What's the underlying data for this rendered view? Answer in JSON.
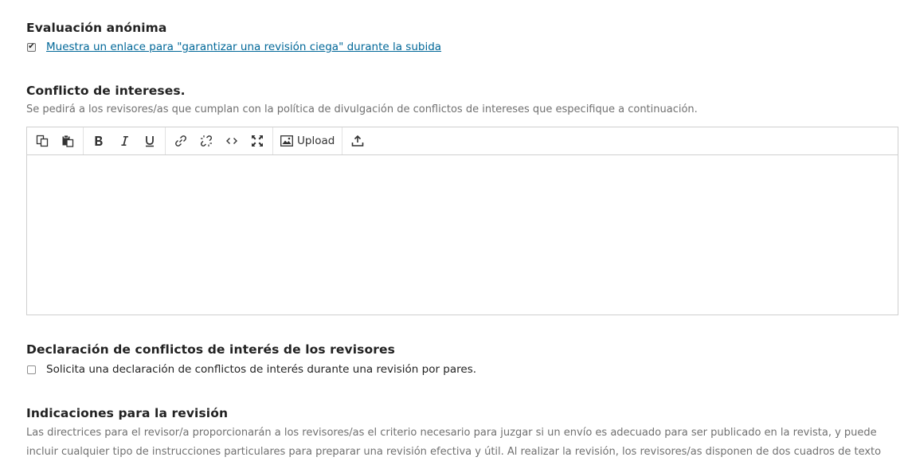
{
  "anonymous_review": {
    "title": "Evaluación anónima",
    "checkbox_checked": true,
    "checkbox_label": "Muestra un enlace para \"garantizar una revisión ciega\" durante la subida"
  },
  "conflict_of_interest": {
    "title": "Conflicto de intereses.",
    "description": "Se pedirá a los revisores/as que cumplan con la política de divulgación de conflictos de intereses que especifique a continuación.",
    "editor": {
      "toolbar": {
        "upload_label": "Upload"
      },
      "content": ""
    }
  },
  "reviewer_competing_interests": {
    "title": "Declaración de conflictos de interés de los revisores",
    "checkbox_checked": false,
    "checkbox_label": "Solicita una declaración de conflictos de interés durante una revisión por pares."
  },
  "review_guidelines": {
    "title": "Indicaciones para la revisión",
    "description_line1": "Las directrices para el revisor/a proporcionarán a los revisores/as el criterio necesario para juzgar si un envío es adecuado para ser publicado en la revista, y puede",
    "description_line2": "incluir cualquier tipo de instrucciones particulares para preparar una revisión efectiva y útil. Al realizar la revisión, los revisores/as disponen de dos cuadros de texto"
  },
  "icons": [
    "copy-icon",
    "paste-icon",
    "bold-icon",
    "italic-icon",
    "underline-icon",
    "link-icon",
    "unlink-icon",
    "code-icon",
    "fullscreen-icon",
    "image-icon",
    "upload-icon"
  ]
}
